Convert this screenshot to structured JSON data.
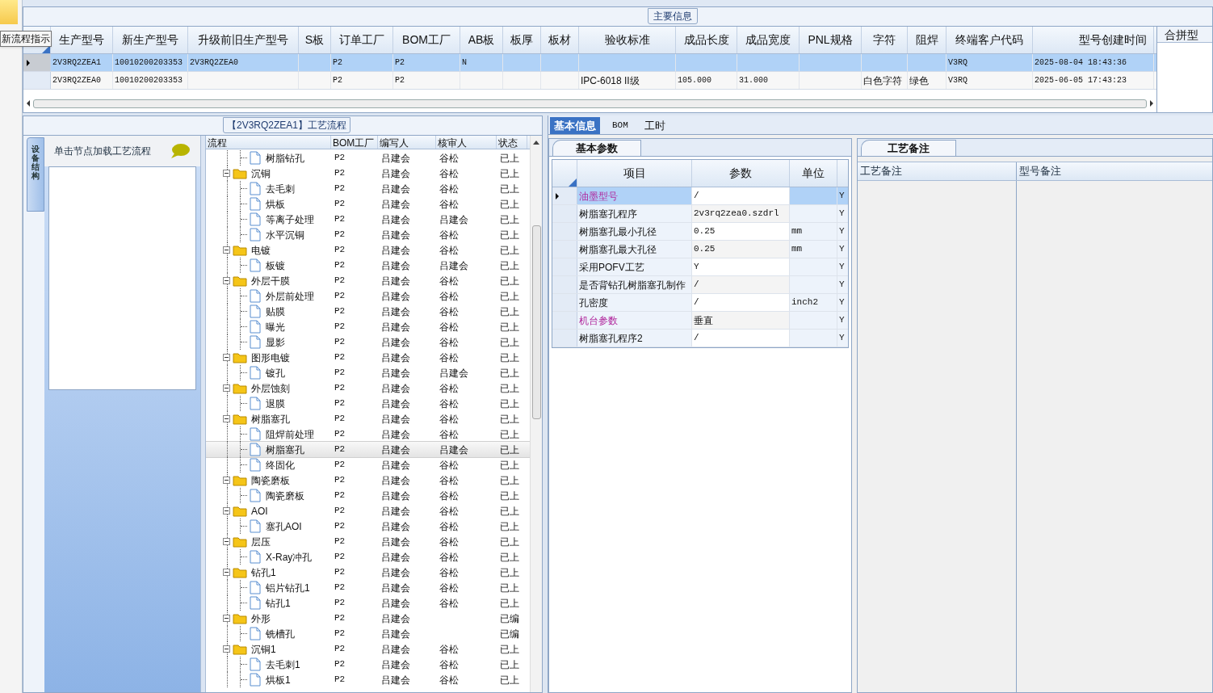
{
  "tooltip": "新流程指示",
  "main_info": {
    "title": "主要信息",
    "columns": [
      "生产型号",
      "新生产型号",
      "升级前旧生产型号",
      "S板",
      "订单工厂",
      "BOM工厂",
      "AB板",
      "板厚",
      "板材",
      "验收标准",
      "成品长度",
      "成品宽度",
      "PNL规格",
      "字符",
      "阻焊",
      "终端客户代码",
      "型号创建时间"
    ],
    "rows": [
      {
        "selected": true,
        "cells": [
          "2V3RQ2ZEA1",
          "10010200203353",
          "2V3RQ2ZEA0",
          null,
          "P2",
          "P2",
          "N",
          null,
          null,
          null,
          null,
          null,
          null,
          null,
          null,
          "V3RQ",
          "2025-08-04 18:43:36"
        ]
      },
      {
        "selected": false,
        "cells": [
          "2V3RQ2ZEA0",
          "10010200203353",
          null,
          null,
          "P2",
          "P2",
          null,
          null,
          null,
          "IPC-6018 II级",
          "105.000",
          "31.000",
          null,
          "白色字符",
          "绿色",
          "V3RQ",
          "2025-06-05 17:43:23"
        ]
      }
    ],
    "side_header": "合拼型"
  },
  "process": {
    "title": "【2V3RQ2ZEA1】工艺流程",
    "side_tab": "设备结构",
    "hint": "单击节点加载工艺流程",
    "columns": [
      "流程",
      "BOM工厂",
      "编写人",
      "核审人",
      "状态"
    ],
    "nodes": [
      {
        "kind": "leaf",
        "name": "树脂钻孔",
        "bom": "P2",
        "author": "吕建会",
        "reviewer": "谷松",
        "status": "已上",
        "selected": false
      },
      {
        "kind": "folder",
        "name": "沉铜",
        "bom": "P2",
        "author": "吕建会",
        "reviewer": "谷松",
        "status": "已上",
        "selected": false,
        "expanded": true,
        "children": [
          {
            "kind": "leaf",
            "name": "去毛刺",
            "bom": "P2",
            "author": "吕建会",
            "reviewer": "谷松",
            "status": "已上",
            "selected": false
          },
          {
            "kind": "leaf",
            "name": "烘板",
            "bom": "P2",
            "author": "吕建会",
            "reviewer": "谷松",
            "status": "已上",
            "selected": false
          },
          {
            "kind": "leaf",
            "name": "等离子处理",
            "bom": "P2",
            "author": "吕建会",
            "reviewer": "吕建会",
            "status": "已上",
            "selected": false
          },
          {
            "kind": "leaf",
            "name": "水平沉铜",
            "bom": "P2",
            "author": "吕建会",
            "reviewer": "谷松",
            "status": "已上",
            "selected": false
          }
        ]
      },
      {
        "kind": "folder",
        "name": "电镀",
        "bom": "P2",
        "author": "吕建会",
        "reviewer": "谷松",
        "status": "已上",
        "selected": false,
        "expanded": true,
        "children": [
          {
            "kind": "leaf",
            "name": "板镀",
            "bom": "P2",
            "author": "吕建会",
            "reviewer": "吕建会",
            "status": "已上",
            "selected": false
          }
        ]
      },
      {
        "kind": "folder",
        "name": "外层干膜",
        "bom": "P2",
        "author": "吕建会",
        "reviewer": "谷松",
        "status": "已上",
        "selected": false,
        "expanded": true,
        "children": [
          {
            "kind": "leaf",
            "name": "外层前处理",
            "bom": "P2",
            "author": "吕建会",
            "reviewer": "谷松",
            "status": "已上",
            "selected": false
          },
          {
            "kind": "leaf",
            "name": "贴膜",
            "bom": "P2",
            "author": "吕建会",
            "reviewer": "谷松",
            "status": "已上",
            "selected": false
          },
          {
            "kind": "leaf",
            "name": "曝光",
            "bom": "P2",
            "author": "吕建会",
            "reviewer": "谷松",
            "status": "已上",
            "selected": false
          },
          {
            "kind": "leaf",
            "name": "显影",
            "bom": "P2",
            "author": "吕建会",
            "reviewer": "谷松",
            "status": "已上",
            "selected": false
          }
        ]
      },
      {
        "kind": "folder",
        "name": "图形电镀",
        "bom": "P2",
        "author": "吕建会",
        "reviewer": "谷松",
        "status": "已上",
        "selected": false,
        "expanded": true,
        "children": [
          {
            "kind": "leaf",
            "name": "镀孔",
            "bom": "P2",
            "author": "吕建会",
            "reviewer": "吕建会",
            "status": "已上",
            "selected": false
          }
        ]
      },
      {
        "kind": "folder",
        "name": "外层蚀刻",
        "bom": "P2",
        "author": "吕建会",
        "reviewer": "谷松",
        "status": "已上",
        "selected": false,
        "expanded": true,
        "children": [
          {
            "kind": "leaf",
            "name": "退膜",
            "bom": "P2",
            "author": "吕建会",
            "reviewer": "谷松",
            "status": "已上",
            "selected": false
          }
        ]
      },
      {
        "kind": "folder",
        "name": "树脂塞孔",
        "bom": "P2",
        "author": "吕建会",
        "reviewer": "谷松",
        "status": "已上",
        "selected": false,
        "expanded": true,
        "children": [
          {
            "kind": "leaf",
            "name": "阻焊前处理",
            "bom": "P2",
            "author": "吕建会",
            "reviewer": "谷松",
            "status": "已上",
            "selected": false
          },
          {
            "kind": "leaf",
            "name": "树脂塞孔",
            "bom": "P2",
            "author": "吕建会",
            "reviewer": "吕建会",
            "status": "已上",
            "selected": true
          },
          {
            "kind": "leaf",
            "name": "终固化",
            "bom": "P2",
            "author": "吕建会",
            "reviewer": "谷松",
            "status": "已上",
            "selected": false
          }
        ]
      },
      {
        "kind": "folder",
        "name": "陶瓷磨板",
        "bom": "P2",
        "author": "吕建会",
        "reviewer": "谷松",
        "status": "已上",
        "selected": false,
        "expanded": true,
        "children": [
          {
            "kind": "leaf",
            "name": "陶瓷磨板",
            "bom": "P2",
            "author": "吕建会",
            "reviewer": "谷松",
            "status": "已上",
            "selected": false
          }
        ]
      },
      {
        "kind": "folder",
        "name": "AOI",
        "bom": "P2",
        "author": "吕建会",
        "reviewer": "谷松",
        "status": "已上",
        "selected": false,
        "expanded": true,
        "children": [
          {
            "kind": "leaf",
            "name": "塞孔AOI",
            "bom": "P2",
            "author": "吕建会",
            "reviewer": "谷松",
            "status": "已上",
            "selected": false
          }
        ]
      },
      {
        "kind": "folder",
        "name": "层压",
        "bom": "P2",
        "author": "吕建会",
        "reviewer": "谷松",
        "status": "已上",
        "selected": false,
        "expanded": true,
        "children": [
          {
            "kind": "leaf",
            "name": "X-Ray冲孔",
            "bom": "P2",
            "author": "吕建会",
            "reviewer": "谷松",
            "status": "已上",
            "selected": false
          }
        ]
      },
      {
        "kind": "folder",
        "name": "钻孔1",
        "bom": "P2",
        "author": "吕建会",
        "reviewer": "谷松",
        "status": "已上",
        "selected": false,
        "expanded": true,
        "children": [
          {
            "kind": "leaf",
            "name": "铝片钻孔1",
            "bom": "P2",
            "author": "吕建会",
            "reviewer": "谷松",
            "status": "已上",
            "selected": false
          },
          {
            "kind": "leaf",
            "name": "钻孔1",
            "bom": "P2",
            "author": "吕建会",
            "reviewer": "谷松",
            "status": "已上",
            "selected": false
          }
        ]
      },
      {
        "kind": "folder",
        "name": "外形",
        "bom": "P2",
        "author": "吕建会",
        "status": "已编",
        "selected": false,
        "expanded": true,
        "children": [
          {
            "kind": "leaf",
            "name": "铣槽孔",
            "bom": "P2",
            "author": "吕建会",
            "status": "已编",
            "selected": false
          }
        ]
      },
      {
        "kind": "folder",
        "name": "沉铜1",
        "bom": "P2",
        "author": "吕建会",
        "reviewer": "谷松",
        "status": "已上",
        "selected": false,
        "expanded": true,
        "children": [
          {
            "kind": "leaf",
            "name": "去毛刺1",
            "bom": "P2",
            "author": "吕建会",
            "reviewer": "谷松",
            "status": "已上",
            "selected": false
          },
          {
            "kind": "leaf",
            "name": "烘板1",
            "bom": "P2",
            "author": "吕建会",
            "reviewer": "谷松",
            "status": "已上",
            "selected": false
          }
        ]
      }
    ]
  },
  "detail_tabs": [
    {
      "label": "基本信息",
      "selected": true
    },
    {
      "label": "BOM",
      "selected": false
    },
    {
      "label": "工时",
      "selected": false
    }
  ],
  "basic_params": {
    "title": "基本参数",
    "columns": [
      "项目",
      "参数",
      "单位"
    ],
    "rows": [
      {
        "name": "油墨型号",
        "value": "/",
        "flag": "Y",
        "highlighted": true,
        "selected": true
      },
      {
        "name": "树脂塞孔程序",
        "value": "2v3rq2zea0.szdrl",
        "flag": "Y",
        "highlighted": false,
        "selected": false
      },
      {
        "name": "树脂塞孔最小孔径",
        "value": "0.25",
        "unit": "mm",
        "flag": "Y",
        "highlighted": false,
        "selected": false
      },
      {
        "name": "树脂塞孔最大孔径",
        "value": "0.25",
        "unit": "mm",
        "flag": "Y",
        "highlighted": false,
        "selected": false
      },
      {
        "name": "采用POFV工艺",
        "value": "Y",
        "flag": "Y",
        "highlighted": false,
        "selected": false
      },
      {
        "name": "是否背钻孔树脂塞孔制作",
        "value": "/",
        "flag": "Y",
        "highlighted": false,
        "selected": false
      },
      {
        "name": "孔密度",
        "value": "/",
        "unit": "inch2",
        "flag": "Y",
        "highlighted": false,
        "selected": false
      },
      {
        "name": "机台参数",
        "value": "垂直",
        "flag": "Y",
        "highlighted": true,
        "selected": false
      },
      {
        "name": "树脂塞孔程序2",
        "value": "/",
        "flag": "Y",
        "highlighted": false,
        "selected": false
      }
    ]
  },
  "remarks": {
    "title": "工艺备注",
    "columns": [
      "工艺备注",
      "型号备注"
    ]
  }
}
